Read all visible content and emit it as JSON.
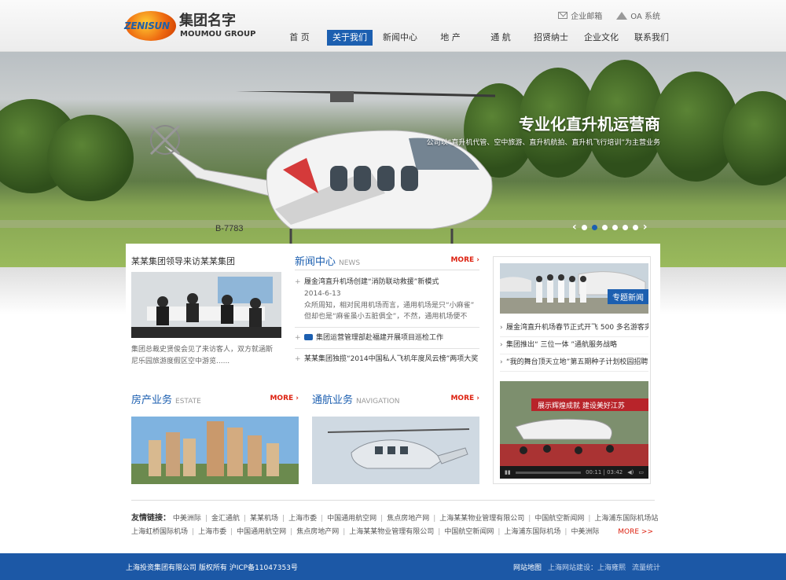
{
  "brand": {
    "logo_text": "ZENISUN",
    "name_cn": "集团名字",
    "name_en": "MOUMOU GROUP",
    "accent": "#1c5fb0",
    "more_color": "#dd2211"
  },
  "toplinks": [
    {
      "icon": "mail-icon",
      "label": "企业邮箱"
    },
    {
      "icon": "oa-icon",
      "label": "OA 系统"
    }
  ],
  "nav": [
    {
      "label": "首 页",
      "active": false
    },
    {
      "label": "关于我们",
      "active": true
    },
    {
      "label": "新闻中心",
      "active": false
    },
    {
      "label": "地 产",
      "active": false
    },
    {
      "label": "通 航",
      "active": false
    },
    {
      "label": "招贤纳士",
      "active": false
    },
    {
      "label": "企业文化",
      "active": false
    },
    {
      "label": "联系我们",
      "active": false
    }
  ],
  "banner": {
    "title": "专业化直升机运营商",
    "subtitle": "公司以“直升机代管、空中旅游、直升机航拍、直升机飞行培训”为主营业务",
    "registration": "B-7783",
    "slide_count": 6,
    "active_slide": 1,
    "prev_icon": "chevron-left-icon",
    "next_icon": "chevron-right-icon"
  },
  "lead": {
    "title": "某某集团领导来访某某集团",
    "text": "集团总裁史贤俊会见了来访客人，双方就涵斯尼乐园旅游度假区空中游览......"
  },
  "news": {
    "title_cn": "新闻中心",
    "title_en": "NEWS",
    "more": "MORE",
    "featured": {
      "title": "履金湾直升机场创建“消防联动救援”新模式",
      "date": "2014-6-13",
      "summary_1": "众所周知，相对民用机场而言，通用机场是只“小麻雀”",
      "summary_2": "但却也是“麻雀虽小五脏俱全”，不然，通用机场便不"
    },
    "items": [
      "集团运营管理部赴福建开展项目巡检工作",
      "某某集团独揽“2014中国私人飞机年度风云榜”两项大奖"
    ]
  },
  "side": {
    "badge": "专题新闻",
    "items": [
      "履金湾直升机场春节正式开飞 500 多名游客实",
      "集团推出“ 三位一体 ”通航服务战略",
      "“我的舞台顶天立地”第五期种子计划校园招聘"
    ],
    "video": {
      "time": "00:11 | 03:42",
      "play_icon": "play-icon",
      "volume_icon": "volume-icon",
      "fullscreen_icon": "fullscreen-icon",
      "banner_text": "展示辉煌成就  建设美好江苏"
    }
  },
  "estate": {
    "title_cn": "房产业务",
    "title_en": "ESTATE",
    "more": "MORE"
  },
  "aviation": {
    "title_cn": "通航业务",
    "title_en": "NAVIGATION",
    "more": "MORE"
  },
  "links": {
    "label": "友情链接：",
    "row1": [
      "中美洲际",
      "金汇通航",
      "某某机场",
      "上海市委",
      "中国通用航空网",
      "焦点房地产网",
      "上海某某物业管理有限公司",
      "中国航空新闻网",
      "上海浦东国际机场站"
    ],
    "row2": [
      "上海虹桥国际机场",
      "上海市委",
      "中国通用航空网",
      "焦点房地产网",
      "上海某某物业管理有限公司",
      "中国航空新闻网",
      "上海浦东国际机场",
      "中美洲际"
    ],
    "more": "MORE >>"
  },
  "footer": {
    "copyright": "上海投资集团有限公司 版权所有 沪ICP备11047353号",
    "sitemap": "网站地图",
    "builder": "上海网站建设：上海雍熙",
    "stats": "流量统计"
  }
}
